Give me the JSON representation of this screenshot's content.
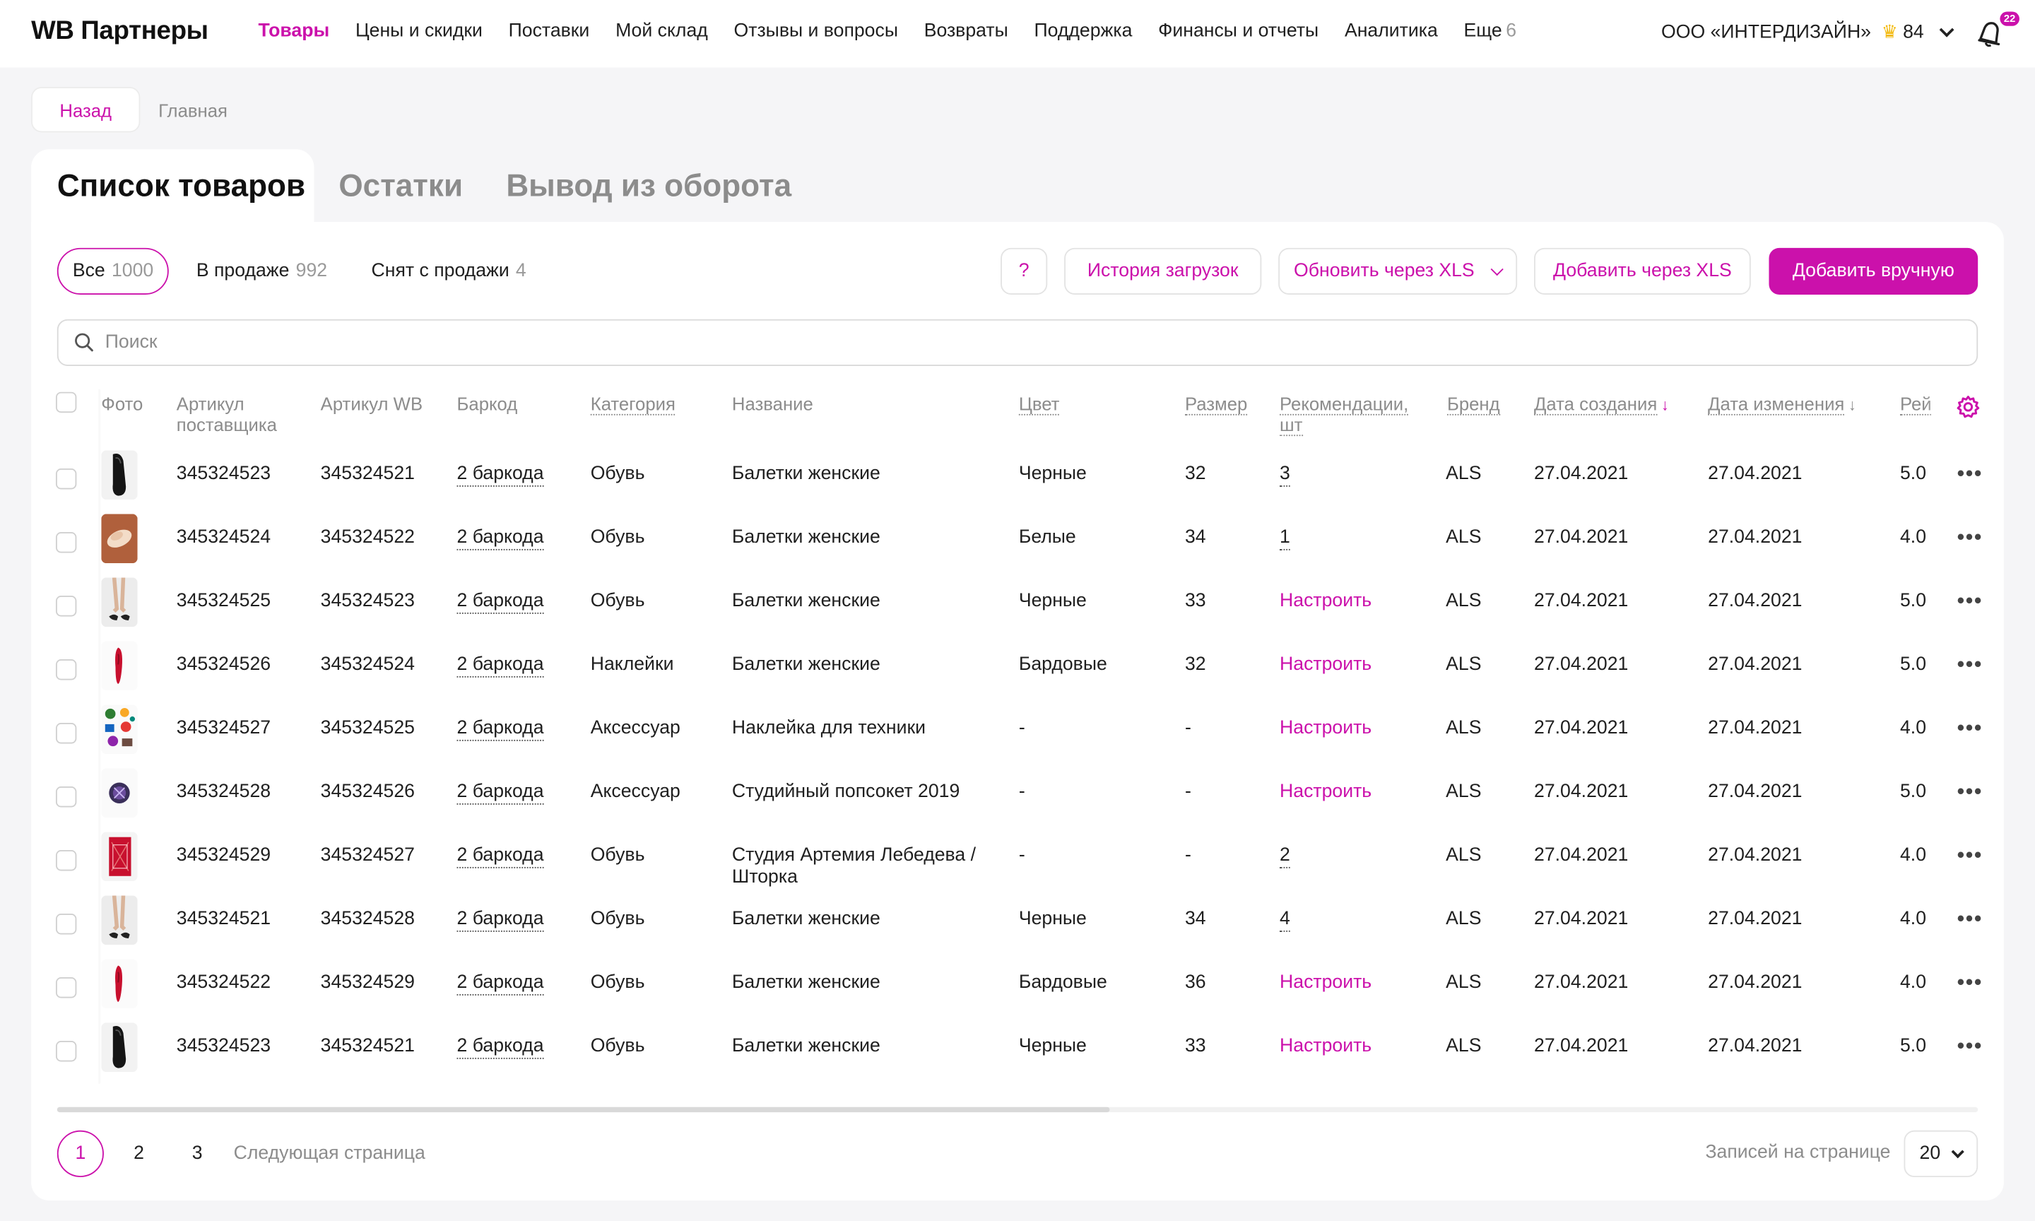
{
  "header": {
    "logo": "WB Партнеры",
    "nav": [
      {
        "label": "Товары",
        "active": true
      },
      {
        "label": "Цены и скидки"
      },
      {
        "label": "Поставки"
      },
      {
        "label": "Мой склад"
      },
      {
        "label": "Отзывы и вопросы"
      },
      {
        "label": "Возвраты"
      },
      {
        "label": "Поддержка"
      },
      {
        "label": "Финансы и отчеты"
      },
      {
        "label": "Аналитика"
      },
      {
        "label": "Еще"
      }
    ],
    "more_count": "6",
    "company": "ООО «ИНТЕРДИЗАЙН»",
    "rating": "84",
    "notifications": "22",
    "accent": "#cb11ab"
  },
  "breadcrumbs": {
    "back": "Назад",
    "home": "Главная"
  },
  "tabs": [
    "Список товаров",
    "Остатки",
    "Вывод из оборота"
  ],
  "filters": [
    {
      "label": "Все",
      "count": "1000"
    },
    {
      "label": "В продаже",
      "count": "992"
    },
    {
      "label": "Снят с продажи",
      "count": "4"
    }
  ],
  "toolbar": {
    "help": "?",
    "history": "История загрузок",
    "update_xls": "Обновить через XLS",
    "add_xls": "Добавить через XLS",
    "add_manual": "Добавить вручную"
  },
  "search": {
    "placeholder": "Поиск"
  },
  "table": {
    "columns": {
      "photo": "Фото",
      "supplier_art_1": "Артикул",
      "supplier_art_2": "поставщика",
      "wb_art": "Артикул WB",
      "barcode": "Баркод",
      "category": "Категория",
      "name": "Название",
      "color": "Цвет",
      "size": "Размер",
      "recs_1": "Рекомендации,",
      "recs_2": "шт",
      "brand": "Бренд",
      "created": "Дата создания",
      "modified": "Дата изменения",
      "rating": "Рей"
    },
    "rows": [
      {
        "thumb": "black-flat",
        "supplier_art": "345324523",
        "wb_art": "345324521",
        "barcode": "2 баркода",
        "category": "Обувь",
        "name": "Балетки женские",
        "color": "Черные",
        "size": "32",
        "recs": "3",
        "recs_link": false,
        "brand": "ALS",
        "created": "27.04.2021",
        "modified": "27.04.2021",
        "rating": "5.0"
      },
      {
        "thumb": "beige-flat",
        "supplier_art": "345324524",
        "wb_art": "345324522",
        "barcode": "2 баркода",
        "category": "Обувь",
        "name": "Балетки женские",
        "color": "Белые",
        "size": "34",
        "recs": "1",
        "recs_link": false,
        "brand": "ALS",
        "created": "27.04.2021",
        "modified": "27.04.2021",
        "rating": "4.0"
      },
      {
        "thumb": "legs",
        "supplier_art": "345324525",
        "wb_art": "345324523",
        "barcode": "2 баркода",
        "category": "Обувь",
        "name": "Балетки женские",
        "color": "Черные",
        "size": "33",
        "recs": "Настроить",
        "recs_link": true,
        "brand": "ALS",
        "created": "27.04.2021",
        "modified": "27.04.2021",
        "rating": "5.0"
      },
      {
        "thumb": "red-heel",
        "supplier_art": "345324526",
        "wb_art": "345324524",
        "barcode": "2 баркода",
        "category": "Наклейки",
        "name": "Балетки женские",
        "color": "Бардовые",
        "size": "32",
        "recs": "Настроить",
        "recs_link": true,
        "brand": "ALS",
        "created": "27.04.2021",
        "modified": "27.04.2021",
        "rating": "5.0"
      },
      {
        "thumb": "stickers",
        "supplier_art": "345324527",
        "wb_art": "345324525",
        "barcode": "2 баркода",
        "category": "Аксессуар",
        "name": "Наклейка для техники",
        "color": "-",
        "size": "-",
        "recs": "Настроить",
        "recs_link": true,
        "brand": "ALS",
        "created": "27.04.2021",
        "modified": "27.04.2021",
        "rating": "4.0"
      },
      {
        "thumb": "popsocket",
        "supplier_art": "345324528",
        "wb_art": "345324526",
        "barcode": "2 баркода",
        "category": "Аксессуар",
        "name": "Студийный попсокет 2019",
        "color": "-",
        "size": "-",
        "recs": "Настроить",
        "recs_link": true,
        "brand": "ALS",
        "created": "27.04.2021",
        "modified": "27.04.2021",
        "rating": "5.0"
      },
      {
        "thumb": "red-box",
        "supplier_art": "345324529",
        "wb_art": "345324527",
        "barcode": "2 баркода",
        "category": "Обувь",
        "name": "Студия Артемия Лебедева / Шторка",
        "color": "-",
        "size": "-",
        "recs": "2",
        "recs_link": false,
        "brand": "ALS",
        "created": "27.04.2021",
        "modified": "27.04.2021",
        "rating": "4.0"
      },
      {
        "thumb": "legs",
        "supplier_art": "345324521",
        "wb_art": "345324528",
        "barcode": "2 баркода",
        "category": "Обувь",
        "name": "Балетки женские",
        "color": "Черные",
        "size": "34",
        "recs": "4",
        "recs_link": false,
        "brand": "ALS",
        "created": "27.04.2021",
        "modified": "27.04.2021",
        "rating": "4.0"
      },
      {
        "thumb": "red-heel",
        "supplier_art": "345324522",
        "wb_art": "345324529",
        "barcode": "2 баркода",
        "category": "Обувь",
        "name": "Балетки женские",
        "color": "Бардовые",
        "size": "36",
        "recs": "Настроить",
        "recs_link": true,
        "brand": "ALS",
        "created": "27.04.2021",
        "modified": "27.04.2021",
        "rating": "4.0"
      },
      {
        "thumb": "black-flat",
        "supplier_art": "345324523",
        "wb_art": "345324521",
        "barcode": "2 баркода",
        "category": "Обувь",
        "name": "Балетки женские",
        "color": "Черные",
        "size": "33",
        "recs": "Настроить",
        "recs_link": true,
        "brand": "ALS",
        "created": "27.04.2021",
        "modified": "27.04.2021",
        "rating": "5.0"
      }
    ]
  },
  "pagination": {
    "pages": [
      "1",
      "2",
      "3"
    ],
    "current": "1",
    "next": "Следующая страница",
    "per_page_label": "Записей на странице",
    "per_page": "20"
  }
}
